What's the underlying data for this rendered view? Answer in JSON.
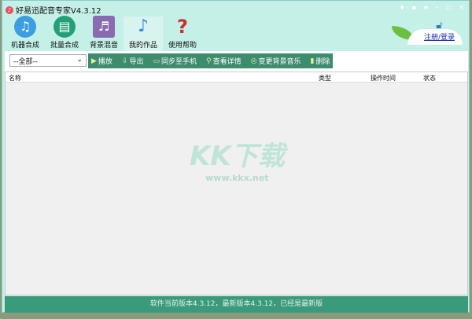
{
  "app": {
    "title": "好易迅配音专家V4.3.12"
  },
  "window_controls": [
    "shirt-icon",
    "message-icon",
    "menu-icon",
    "minimize-icon",
    "maximize-icon",
    "close-icon"
  ],
  "toolbar": [
    {
      "label": "机器合成",
      "icon": "music-note-icon",
      "color": "#3a9ee0"
    },
    {
      "label": "批量合成",
      "icon": "batch-file-icon",
      "color": "#24a078"
    },
    {
      "label": "背景混音",
      "icon": "mix-icon",
      "color": "#8a6ab0"
    },
    {
      "label": "我的作品",
      "icon": "works-icon",
      "color": "#3a8ee0"
    },
    {
      "label": "使用帮助",
      "icon": "help-icon",
      "color": "#c83030"
    }
  ],
  "login": {
    "label": "注册/登录"
  },
  "filter": {
    "selected": "--全部--"
  },
  "actions": [
    {
      "label": "播放"
    },
    {
      "label": "导出"
    },
    {
      "label": "同步至手机"
    },
    {
      "label": "查看详情"
    },
    {
      "label": "变更背景音乐"
    },
    {
      "label": "删除"
    }
  ],
  "table": {
    "columns": [
      "名称",
      "类型",
      "操作时间",
      "状态"
    ]
  },
  "watermark": {
    "text": "KK下载",
    "url": "www.kkx.net"
  },
  "status": {
    "text": "软件当前版本4.3.12，最新版本4.3.12，已经是最新版"
  }
}
